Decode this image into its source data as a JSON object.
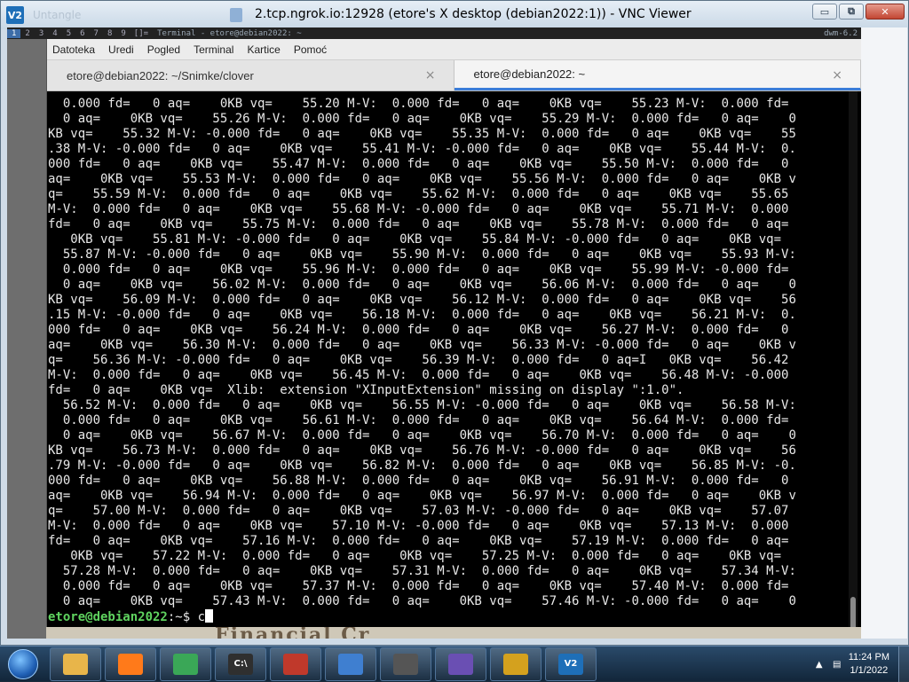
{
  "vnc": {
    "title": "2.tcp.ngrok.io:12928 (etore's X desktop (debian2022:1)) - VNC Viewer",
    "logo": "V2",
    "ghost_text": "Untangle",
    "buttons": {
      "minimize": "▭",
      "restore": "⧉",
      "close": "✕"
    }
  },
  "dwm": {
    "workspaces": [
      "1",
      "2",
      "3",
      "4",
      "5",
      "6",
      "7",
      "8",
      "9"
    ],
    "active_workspace": "1",
    "layout": "[]=",
    "window_title": "Terminal - etore@debian2022: ~",
    "status": "dwm-6.2"
  },
  "terminal": {
    "menu": [
      "Datoteka",
      "Uredi",
      "Pogled",
      "Terminal",
      "Kartice",
      "Pomoć"
    ],
    "tabs": [
      {
        "title": "etore@debian2022: ~/Snimke/clover",
        "active": false
      },
      {
        "title": "etore@debian2022: ~",
        "active": true
      }
    ],
    "close_glyph": "×",
    "lines": [
      "  0.000 fd=   0 aq=    0KB vq=    55.20 M-V:  0.000 fd=   0 aq=    0KB vq=    55.23 M-V:  0.000 fd=",
      "  0 aq=    0KB vq=    55.26 M-V:  0.000 fd=   0 aq=    0KB vq=    55.29 M-V:  0.000 fd=   0 aq=    0",
      "KB vq=    55.32 M-V: -0.000 fd=   0 aq=    0KB vq=    55.35 M-V:  0.000 fd=   0 aq=    0KB vq=    55",
      ".38 M-V: -0.000 fd=   0 aq=    0KB vq=    55.41 M-V: -0.000 fd=   0 aq=    0KB vq=    55.44 M-V:  0.",
      "000 fd=   0 aq=    0KB vq=    55.47 M-V:  0.000 fd=   0 aq=    0KB vq=    55.50 M-V:  0.000 fd=   0",
      "aq=    0KB vq=    55.53 M-V:  0.000 fd=   0 aq=    0KB vq=    55.56 M-V:  0.000 fd=   0 aq=    0KB v",
      "q=    55.59 M-V:  0.000 fd=   0 aq=    0KB vq=    55.62 M-V:  0.000 fd=   0 aq=    0KB vq=    55.65",
      "M-V:  0.000 fd=   0 aq=    0KB vq=    55.68 M-V: -0.000 fd=   0 aq=    0KB vq=    55.71 M-V:  0.000",
      "fd=   0 aq=    0KB vq=    55.75 M-V:  0.000 fd=   0 aq=    0KB vq=    55.78 M-V:  0.000 fd=   0 aq=",
      "   0KB vq=    55.81 M-V: -0.000 fd=   0 aq=    0KB vq=    55.84 M-V: -0.000 fd=   0 aq=    0KB vq=",
      "  55.87 M-V: -0.000 fd=   0 aq=    0KB vq=    55.90 M-V:  0.000 fd=   0 aq=    0KB vq=    55.93 M-V:",
      "  0.000 fd=   0 aq=    0KB vq=    55.96 M-V:  0.000 fd=   0 aq=    0KB vq=    55.99 M-V: -0.000 fd=",
      "  0 aq=    0KB vq=    56.02 M-V:  0.000 fd=   0 aq=    0KB vq=    56.06 M-V:  0.000 fd=   0 aq=    0",
      "KB vq=    56.09 M-V:  0.000 fd=   0 aq=    0KB vq=    56.12 M-V:  0.000 fd=   0 aq=    0KB vq=    56",
      ".15 M-V: -0.000 fd=   0 aq=    0KB vq=    56.18 M-V:  0.000 fd=   0 aq=    0KB vq=    56.21 M-V:  0.",
      "000 fd=   0 aq=    0KB vq=    56.24 M-V:  0.000 fd=   0 aq=    0KB vq=    56.27 M-V:  0.000 fd=   0",
      "aq=    0KB vq=    56.30 M-V:  0.000 fd=   0 aq=    0KB vq=    56.33 M-V: -0.000 fd=   0 aq=    0KB v",
      "q=    56.36 M-V: -0.000 fd=   0 aq=    0KB vq=    56.39 M-V:  0.000 fd=   0 aq=I   0KB vq=    56.42",
      "M-V:  0.000 fd=   0 aq=    0KB vq=    56.45 M-V:  0.000 fd=   0 aq=    0KB vq=    56.48 M-V: -0.000",
      "fd=   0 aq=    0KB vq=  Xlib:  extension \"XInputExtension\" missing on display \":1.0\".",
      "  56.52 M-V:  0.000 fd=   0 aq=    0KB vq=    56.55 M-V: -0.000 fd=   0 aq=    0KB vq=    56.58 M-V:",
      "  0.000 fd=   0 aq=    0KB vq=    56.61 M-V:  0.000 fd=   0 aq=    0KB vq=    56.64 M-V:  0.000 fd=",
      "  0 aq=    0KB vq=    56.67 M-V:  0.000 fd=   0 aq=    0KB vq=    56.70 M-V:  0.000 fd=   0 aq=    0",
      "KB vq=    56.73 M-V:  0.000 fd=   0 aq=    0KB vq=    56.76 M-V: -0.000 fd=   0 aq=    0KB vq=    56",
      ".79 M-V: -0.000 fd=   0 aq=    0KB vq=    56.82 M-V:  0.000 fd=   0 aq=    0KB vq=    56.85 M-V: -0.",
      "000 fd=   0 aq=    0KB vq=    56.88 M-V:  0.000 fd=   0 aq=    0KB vq=    56.91 M-V:  0.000 fd=   0",
      "aq=    0KB vq=    56.94 M-V:  0.000 fd=   0 aq=    0KB vq=    56.97 M-V:  0.000 fd=   0 aq=    0KB v",
      "q=    57.00 M-V:  0.000 fd=   0 aq=    0KB vq=    57.03 M-V: -0.000 fd=   0 aq=    0KB vq=    57.07",
      "M-V:  0.000 fd=   0 aq=    0KB vq=    57.10 M-V: -0.000 fd=   0 aq=    0KB vq=    57.13 M-V:  0.000",
      "fd=   0 aq=    0KB vq=    57.16 M-V:  0.000 fd=   0 aq=    0KB vq=    57.19 M-V:  0.000 fd=   0 aq=",
      "   0KB vq=    57.22 M-V:  0.000 fd=   0 aq=    0KB vq=    57.25 M-V:  0.000 fd=   0 aq=    0KB vq=",
      "  57.28 M-V:  0.000 fd=   0 aq=    0KB vq=    57.31 M-V:  0.000 fd=   0 aq=    0KB vq=    57.34 M-V:",
      "  0.000 fd=   0 aq=    0KB vq=    57.37 M-V:  0.000 fd=   0 aq=    0KB vq=    57.40 M-V:  0.000 fd=",
      "  0 aq=    0KB vq=    57.43 M-V:  0.000 fd=   0 aq=    0KB vq=    57.46 M-V: -0.000 fd=   0 aq=    0"
    ],
    "prompt": "etore@debian2022",
    "prompt_suffix": ":~$ ",
    "input": "c"
  },
  "underlay_text": "Financial Cr",
  "taskbar": {
    "items": [
      {
        "name": "explorer",
        "icon": "folder-icon",
        "color": "#e8b54a",
        "label": ""
      },
      {
        "name": "firefox",
        "icon": "firefox-icon",
        "color": "#ff7a1a",
        "label": ""
      },
      {
        "name": "chrome",
        "icon": "chrome-icon",
        "color": "#3aa757",
        "label": ""
      },
      {
        "name": "cmd",
        "icon": "terminal-icon",
        "color": "#2f2f2f",
        "label": "C:\\"
      },
      {
        "name": "toolbox",
        "icon": "toolbox-icon",
        "color": "#c0392b",
        "label": ""
      },
      {
        "name": "control-panel",
        "icon": "control-panel-icon",
        "color": "#3f7fd0",
        "label": ""
      },
      {
        "name": "record",
        "icon": "record-icon",
        "color": "#555555",
        "label": ""
      },
      {
        "name": "archive",
        "icon": "archive-icon",
        "color": "#6a4fb3",
        "label": ""
      },
      {
        "name": "tool",
        "icon": "tool-icon",
        "color": "#d4a11e",
        "label": ""
      },
      {
        "name": "vnc-viewer",
        "icon": "vnc-viewer-icon",
        "color": "#1e6fb8",
        "label": "V2"
      }
    ],
    "time": "11:24 PM",
    "date": "1/1/2022"
  }
}
